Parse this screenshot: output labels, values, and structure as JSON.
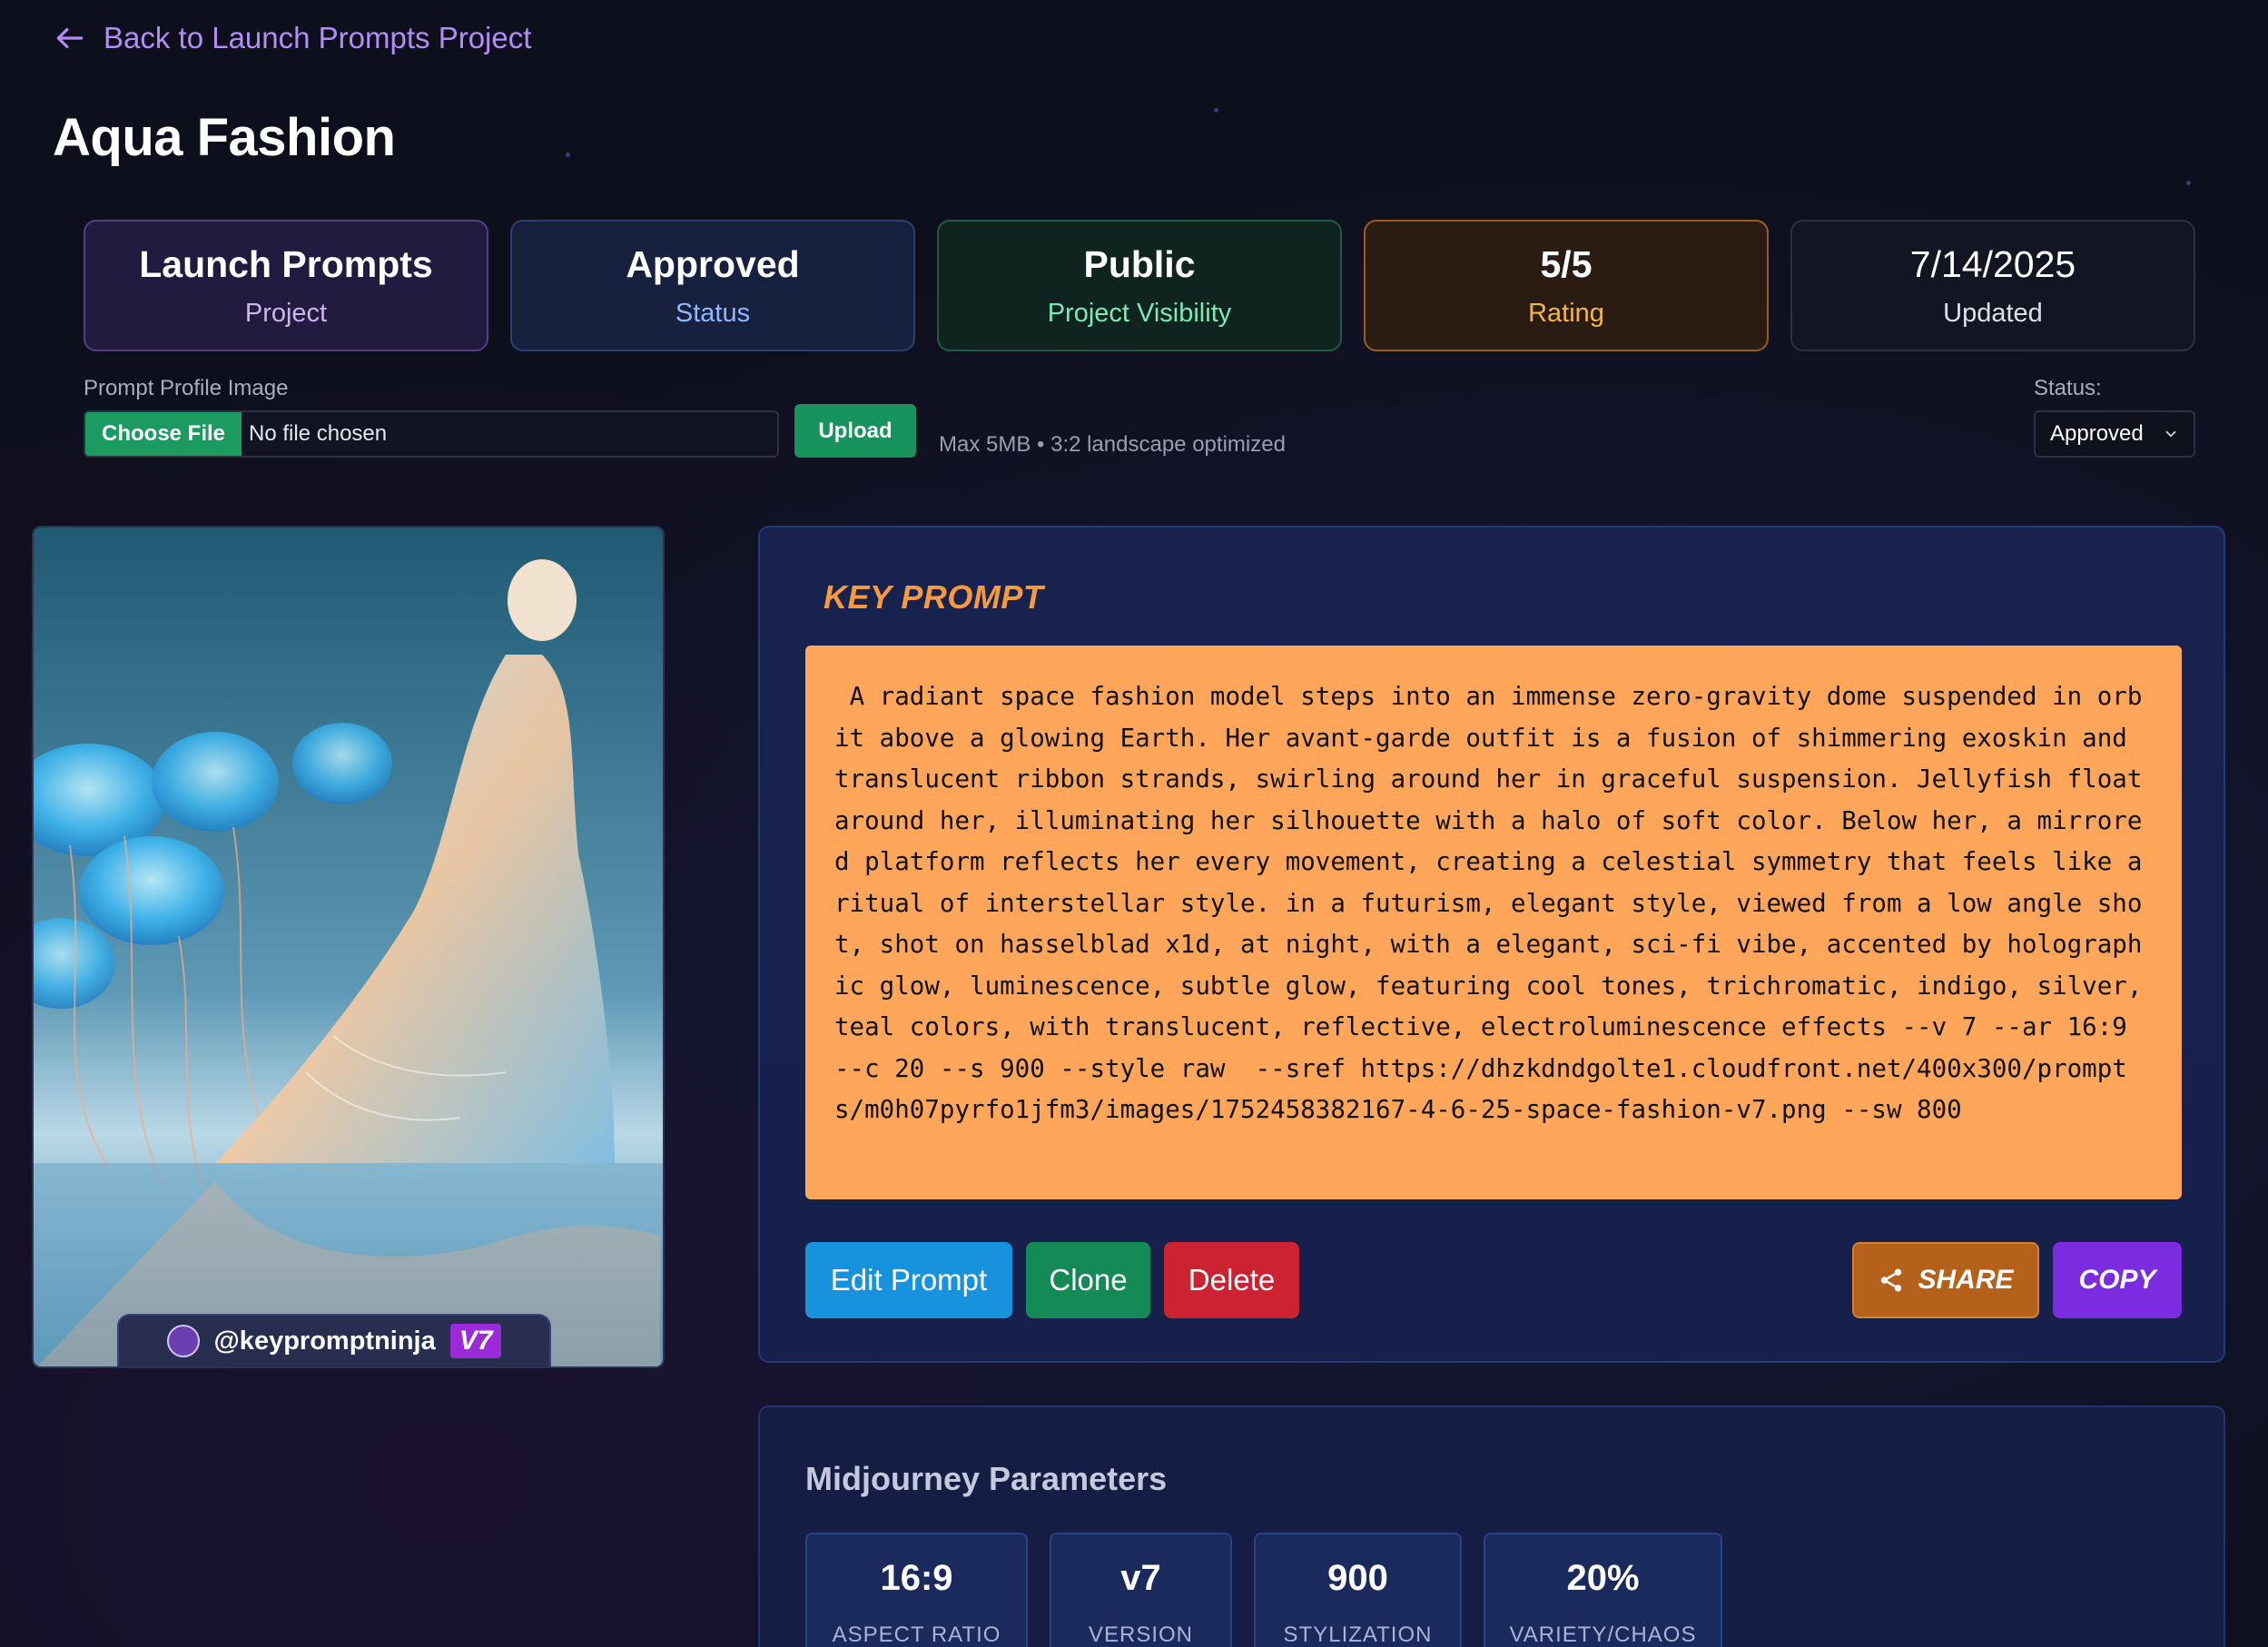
{
  "nav": {
    "back_label": "Back to Launch Prompts Project"
  },
  "page": {
    "title": "Aqua Fashion"
  },
  "stats": [
    {
      "value": "Launch Prompts",
      "label": "Project"
    },
    {
      "value": "Approved",
      "label": "Status"
    },
    {
      "value": "Public",
      "label": "Project Visibility"
    },
    {
      "value": "5/5",
      "label": "Rating"
    },
    {
      "value": "7/14/2025",
      "label": "Updated"
    }
  ],
  "upload": {
    "label": "Prompt Profile Image",
    "choose_label": "Choose File",
    "file_text": "No file chosen",
    "upload_label": "Upload",
    "hint": "Max 5MB • 3:2 landscape optimized"
  },
  "status_select": {
    "label": "Status:",
    "value": "Approved"
  },
  "image": {
    "watermark_handle": "@keypromptninja",
    "watermark_badge": "V7"
  },
  "prompt": {
    "title": "KEY PROMPT",
    "text": " A radiant space fashion model steps into an immense zero-gravity dome suspended in orbit above a glowing Earth. Her avant-garde outfit is a fusion of shimmering exoskin and translucent ribbon strands, swirling around her in graceful suspension. Jellyfish float around her, illuminating her silhouette with a halo of soft color. Below her, a mirrored platform reflects her every movement, creating a celestial symmetry that feels like a ritual of interstellar style. in a futurism, elegant style, viewed from a low angle shot, shot on hasselblad x1d, at night, with a elegant, sci-fi vibe, accented by holographic glow, luminescence, subtle glow, featuring cool tones, trichromatic, indigo, silver, teal colors, with translucent, reflective, electroluminescence effects --v 7 --ar 16:9 --c 20 --s 900 --style raw  --sref https://dhzkdndgolte1.cloudfront.net/400x300/prompts/m0h07pyrfo1jfm3/images/1752458382167-4-6-25-space-fashion-v7.png --sw 800",
    "buttons": {
      "edit": "Edit Prompt",
      "clone": "Clone",
      "delete": "Delete",
      "share": "SHARE",
      "copy": "COPY"
    }
  },
  "parameters": {
    "title": "Midjourney Parameters",
    "items": [
      {
        "value": "16:9",
        "label": "ASPECT RATIO"
      },
      {
        "value": "v7",
        "label": "VERSION"
      },
      {
        "value": "900",
        "label": "STYLIZATION"
      },
      {
        "value": "20%",
        "label": "VARIETY/CHAOS"
      }
    ]
  },
  "colors": {
    "background": "#0e0f1c",
    "accent_purple": "#b48cf5",
    "prompt_bg": "#ffa65a",
    "prompt_title": "#f59a3f"
  },
  "icons": [
    "arrow-left-icon",
    "chevron-down-icon",
    "share-icon",
    "ninja-logo-icon"
  ]
}
